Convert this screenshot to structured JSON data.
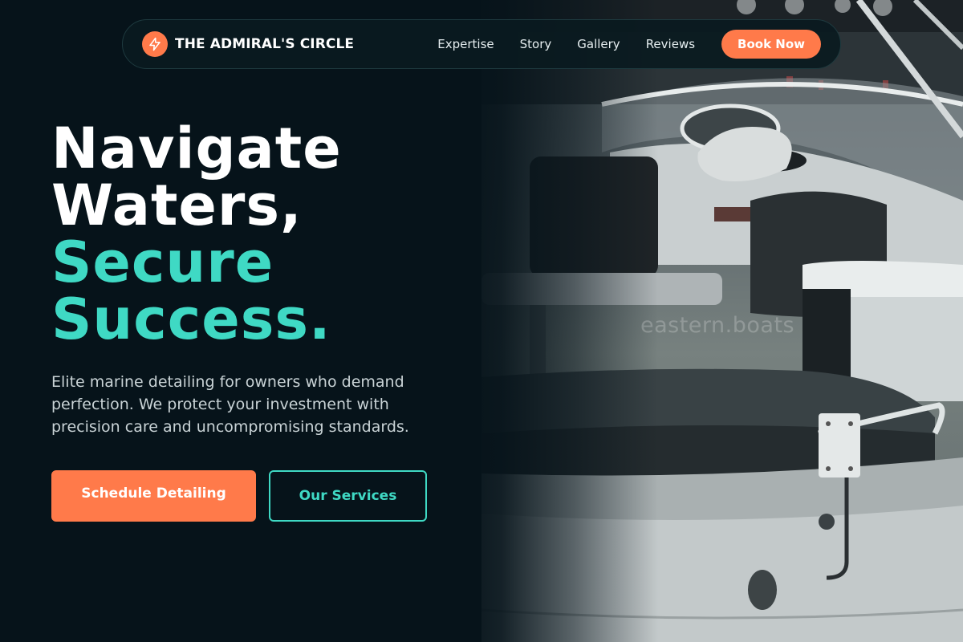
{
  "nav": {
    "brand_name": "THE ADMIRAL'S CIRCLE",
    "brand_icon": "lightning-bolt-icon",
    "links": [
      {
        "label": "Expertise"
      },
      {
        "label": "Story"
      },
      {
        "label": "Gallery"
      },
      {
        "label": "Reviews"
      }
    ],
    "cta_label": "Book Now"
  },
  "hero": {
    "headline_line1": "Navigate",
    "headline_line2": "Waters,",
    "headline_accent_line1": "Secure",
    "headline_accent_line2": "Success.",
    "subtext": "Elite marine detailing for owners who demand perfection. We protect your investment with precision care and uncompromising standards.",
    "primary_cta": "Schedule Detailing",
    "secondary_cta": "Our Services",
    "image_watermark": "eastern.boats"
  },
  "colors": {
    "background": "#06131a",
    "accent_orange": "#ff7a4a",
    "accent_teal": "#3fd9c4"
  }
}
